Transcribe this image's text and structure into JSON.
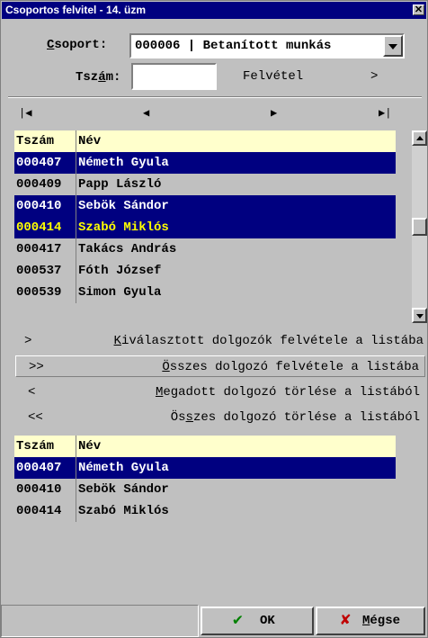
{
  "window": {
    "title": "Csoportos felvitel - 14. üzm",
    "close_glyph": "✕"
  },
  "form": {
    "csoport_label": "Csoport:",
    "csoport_value": "000006 | Betanított munkás",
    "tszam_label": "Tszám:",
    "tszam_value": "",
    "felvetel_label": "Felvétel",
    "felvetel_arrow": ">"
  },
  "nav": {
    "first": "|◀",
    "prev": "◀",
    "next": "▶",
    "last": "▶|"
  },
  "columns": {
    "tszam": "Tszám",
    "nev": "Név"
  },
  "source_list": [
    {
      "tszam": "000407",
      "nev": "Németh Gyula",
      "selected": true,
      "current": false
    },
    {
      "tszam": "000409",
      "nev": "Papp László",
      "selected": false,
      "current": false
    },
    {
      "tszam": "000410",
      "nev": "Sebök Sándor",
      "selected": true,
      "current": false
    },
    {
      "tszam": "000414",
      "nev": "Szabó Miklós",
      "selected": true,
      "current": true
    },
    {
      "tszam": "000417",
      "nev": "Takács András",
      "selected": false,
      "current": false
    },
    {
      "tszam": "000537",
      "nev": "Fóth József",
      "selected": false,
      "current": false
    },
    {
      "tszam": "000539",
      "nev": "Simon Gyula",
      "selected": false,
      "current": false
    }
  ],
  "actions": {
    "add_selected": {
      "symbol": ">",
      "label": "Kiválasztott dolgozók felvétele a listába"
    },
    "add_all": {
      "symbol": ">>",
      "label": "Összes dolgozó felvétele a listába"
    },
    "remove_one": {
      "symbol": "<",
      "label": "Megadott dolgozó törlése a listából"
    },
    "remove_all": {
      "symbol": "<<",
      "label": "Összes dolgozó törlése a listából"
    }
  },
  "target_list": [
    {
      "tszam": "000407",
      "nev": "Németh Gyula",
      "selected": true
    },
    {
      "tszam": "000410",
      "nev": "Sebök Sándor",
      "selected": false
    },
    {
      "tszam": "000414",
      "nev": "Szabó Miklós",
      "selected": false
    }
  ],
  "buttons": {
    "ok": "OK",
    "cancel": "Mégse"
  },
  "colors": {
    "selection": "#000080",
    "current_text": "#ffff00",
    "header_bg": "#ffffcc",
    "ok_icon": "#008000",
    "cancel_icon": "#c00000"
  }
}
